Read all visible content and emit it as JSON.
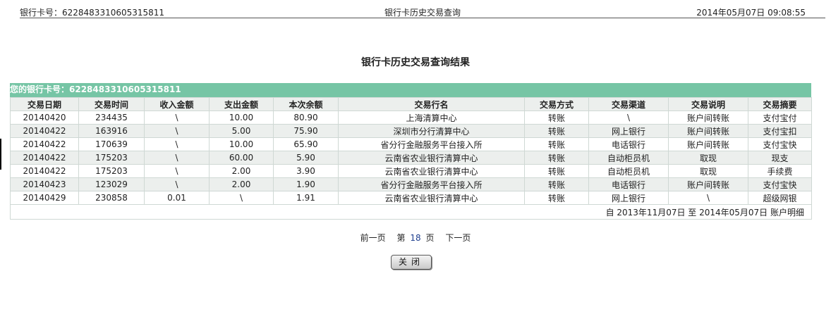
{
  "header": {
    "card_label": "银行卡号：6228483310605315811",
    "title": "银行卡历史交易查询",
    "datetime": "2014年05月07日 09:08:55"
  },
  "page_title": "银行卡历史交易查询结果",
  "card_bar": "您的银行卡号：6228483310605315811",
  "table": {
    "columns": [
      "交易日期",
      "交易时间",
      "收入金额",
      "支出金额",
      "本次余额",
      "交易行名",
      "交易方式",
      "交易渠道",
      "交易说明",
      "交易摘要"
    ],
    "rows": [
      [
        "20140420",
        "234435",
        "\\",
        "10.00",
        "80.90",
        "上海清算中心",
        "转账",
        "\\",
        "账户间转账",
        "支付宝付"
      ],
      [
        "20140422",
        "163916",
        "\\",
        "5.00",
        "75.90",
        "深圳市分行清算中心",
        "转账",
        "网上银行",
        "账户间转账",
        "支付宝扣"
      ],
      [
        "20140422",
        "170639",
        "\\",
        "10.00",
        "65.90",
        "省分行金融服务平台接入所",
        "转账",
        "电话银行",
        "账户间转账",
        "支付宝快"
      ],
      [
        "20140422",
        "175203",
        "\\",
        "60.00",
        "5.90",
        "云南省农业银行清算中心",
        "转账",
        "自动柜员机",
        "取现",
        "现支"
      ],
      [
        "20140422",
        "175203",
        "\\",
        "2.00",
        "3.90",
        "云南省农业银行清算中心",
        "转账",
        "自动柜员机",
        "取现",
        "手续费"
      ],
      [
        "20140423",
        "123029",
        "\\",
        "2.00",
        "1.90",
        "省分行金融服务平台接入所",
        "转账",
        "电话银行",
        "账户间转账",
        "支付宝快"
      ],
      [
        "20140429",
        "230858",
        "0.01",
        "\\",
        "1.91",
        "云南省农业银行清算中心",
        "转账",
        "网上银行",
        "\\",
        "超级网银"
      ]
    ],
    "summary": "自  2013年11月07日  至  2014年05月07日  账户明细"
  },
  "pager": {
    "prev": "前一页",
    "page_prefix": "第",
    "page_number": "18",
    "page_suffix": "页",
    "next": "下一页"
  },
  "close_button": "关闭"
}
